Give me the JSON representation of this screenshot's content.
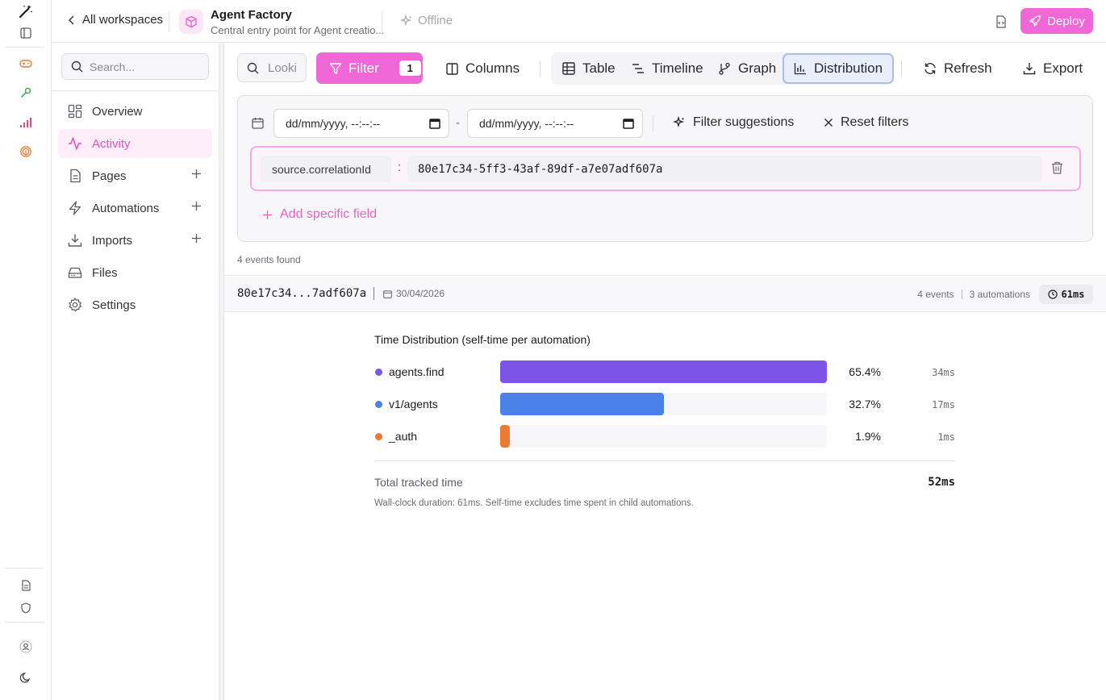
{
  "workspace": {
    "back_label": "All workspaces",
    "title": "Agent Factory",
    "subtitle": "Central entry point for Agent creatio...",
    "status": "Offline",
    "deploy_label": "Deploy"
  },
  "sidebar": {
    "search_placeholder": "Search...",
    "items": [
      {
        "label": "Overview",
        "icon": "grid-icon",
        "active": false,
        "addable": false
      },
      {
        "label": "Activity",
        "icon": "activity-icon",
        "active": true,
        "addable": false
      },
      {
        "label": "Pages",
        "icon": "page-icon",
        "active": false,
        "addable": true
      },
      {
        "label": "Automations",
        "icon": "bolt-icon",
        "active": false,
        "addable": true
      },
      {
        "label": "Imports",
        "icon": "download-icon",
        "active": false,
        "addable": true
      },
      {
        "label": "Files",
        "icon": "drive-icon",
        "active": false,
        "addable": false
      },
      {
        "label": "Settings",
        "icon": "gear-icon",
        "active": false,
        "addable": false
      }
    ]
  },
  "toolbar": {
    "search_placeholder": "Looki",
    "filter_label": "Filter",
    "filter_count": "1",
    "columns_label": "Columns",
    "views": [
      "Table",
      "Timeline",
      "Graph",
      "Distribution"
    ],
    "active_view": "Distribution",
    "refresh_label": "Refresh",
    "export_label": "Export"
  },
  "filters": {
    "date_from_placeholder": "dd/mm/yyyy, --:--:--",
    "date_to_placeholder": "dd/mm/yyyy, --:--:--",
    "date_separator": "-",
    "suggestions_label": "Filter suggestions",
    "reset_label": "Reset filters",
    "condition": {
      "field": "source.correlationId",
      "separator": ":",
      "value": "80e17c34-5ff3-43af-89df-a7e07adf607a"
    },
    "add_field_label": "Add specific field"
  },
  "results": {
    "count_text": "4 events found",
    "group": {
      "id": "80e17c34...7adf607a",
      "date": "30/04/2026",
      "events": "4 events",
      "automations": "3 automations",
      "duration": "61ms"
    }
  },
  "distribution": {
    "title": "Time Distribution (self-time per automation)",
    "rows": [
      {
        "name": "agents.find",
        "percent": "65.4%",
        "ms": "34ms",
        "share": 1.0,
        "color": "#7c55e6"
      },
      {
        "name": "v1/agents",
        "percent": "32.7%",
        "ms": "17ms",
        "share": 0.5,
        "color": "#4a82ea"
      },
      {
        "name": "_auth",
        "percent": "1.9%",
        "ms": "1ms",
        "share": 0.029,
        "color": "#ec7a30"
      }
    ],
    "total_label": "Total tracked time",
    "total_value": "52ms",
    "footnote": "Wall-clock duration: 61ms. Self-time excludes time spent in child automations."
  },
  "colors": {
    "accent": "#f067d7",
    "accent_light": "#fdeefa",
    "active_view_border": "#a9bde9"
  }
}
